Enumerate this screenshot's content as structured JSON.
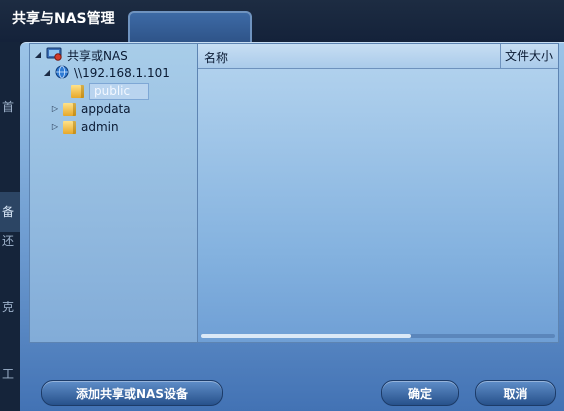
{
  "window": {
    "title": "共享与NAS管理"
  },
  "sidenav": {
    "items": [
      "首",
      "备",
      "还",
      "克",
      "工"
    ]
  },
  "tree": {
    "root": "共享或NAS",
    "host": "\\\\192.168.1.101",
    "folders": [
      "public",
      "appdata",
      "admin"
    ]
  },
  "list": {
    "columns": [
      "名称",
      "文件大小"
    ]
  },
  "buttons": {
    "add": "添加共享或NAS设备",
    "ok": "确定",
    "cancel": "取消"
  },
  "colors": {
    "dialog_top": "#9cc4e8",
    "dialog_bottom": "#4272b4",
    "button": "#27518b"
  }
}
